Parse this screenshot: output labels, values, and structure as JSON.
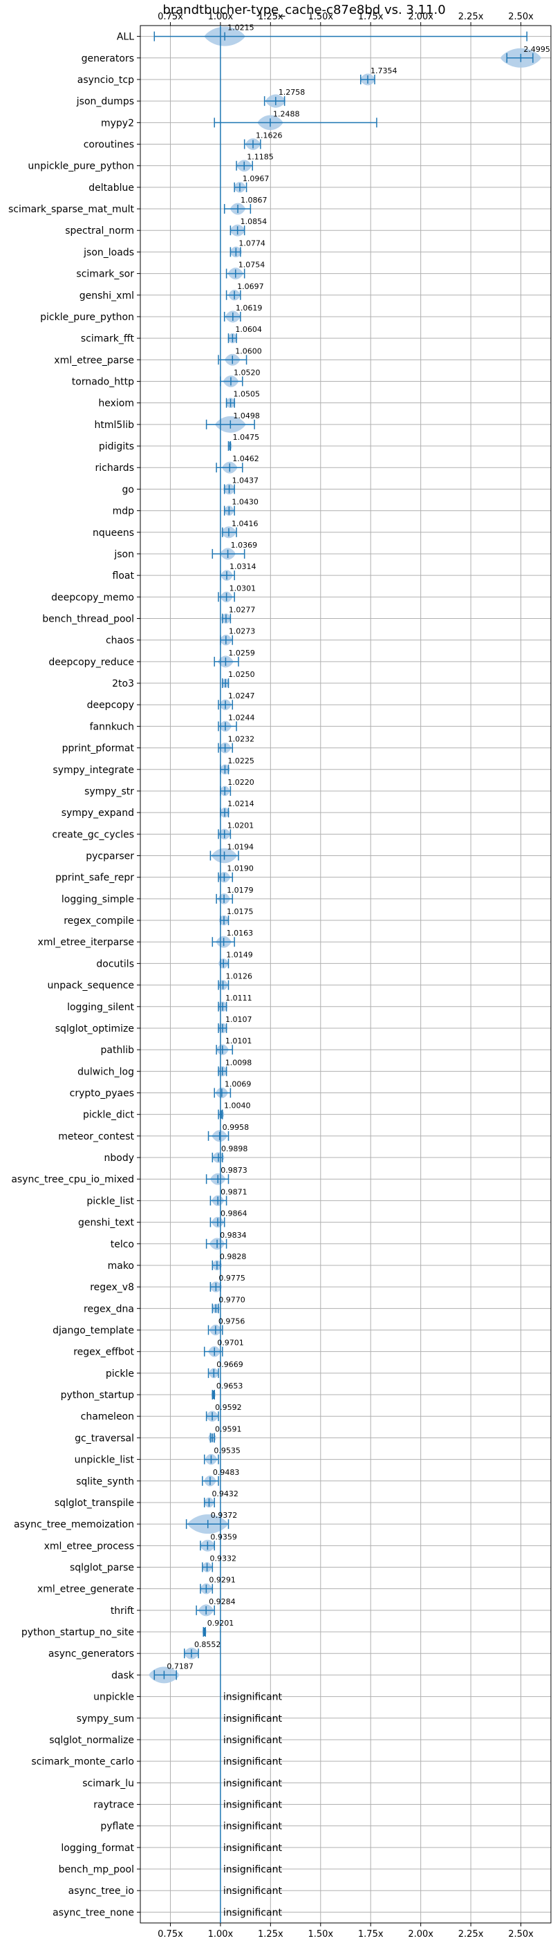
{
  "chart_data": {
    "type": "violin",
    "title": "brandtbucher-type_cache-c87e8bd vs. 3.11.0",
    "xlim": [
      0.6,
      2.65
    ],
    "xticks": [
      "0.75x",
      "1.00x",
      "1.25x",
      "1.50x",
      "1.75x",
      "2.00x",
      "2.25x",
      "2.50x"
    ],
    "xtick_values": [
      0.75,
      1.0,
      1.25,
      1.5,
      1.75,
      2.0,
      2.25,
      2.5
    ],
    "reference_line": 1.0,
    "grid": true,
    "colors": {
      "accent": "#1f77b4",
      "violin_fill": "#a9c9e6",
      "grid": "#b0b0b0"
    },
    "insignificant_label": "insignificant",
    "benchmarks": [
      {
        "name": "ALL",
        "value": 1.0215,
        "label": "1.0215",
        "min": 0.67,
        "max": 2.53,
        "spread": 0.04
      },
      {
        "name": "generators",
        "value": 2.4995,
        "label": "2.4995",
        "min": 2.43,
        "max": 2.56,
        "spread": 0.04
      },
      {
        "name": "asyncio_tcp",
        "value": 1.7354,
        "label": "1.7354",
        "min": 1.7,
        "max": 1.77,
        "spread": 0.015
      },
      {
        "name": "json_dumps",
        "value": 1.2758,
        "label": "1.2758",
        "min": 1.22,
        "max": 1.32,
        "spread": 0.02
      },
      {
        "name": "mypy2",
        "value": 1.2488,
        "label": "1.2488",
        "min": 0.97,
        "max": 1.78,
        "spread": 0.025
      },
      {
        "name": "coroutines",
        "value": 1.1626,
        "label": "1.1626",
        "min": 1.12,
        "max": 1.2,
        "spread": 0.015
      },
      {
        "name": "unpickle_pure_python",
        "value": 1.1185,
        "label": "1.1185",
        "min": 1.08,
        "max": 1.16,
        "spread": 0.015
      },
      {
        "name": "deltablue",
        "value": 1.0967,
        "label": "1.0967",
        "min": 1.07,
        "max": 1.13,
        "spread": 0.012
      },
      {
        "name": "scimark_sparse_mat_mult",
        "value": 1.0867,
        "label": "1.0867",
        "min": 1.02,
        "max": 1.15,
        "spread": 0.015
      },
      {
        "name": "spectral_norm",
        "value": 1.0854,
        "label": "1.0854",
        "min": 1.05,
        "max": 1.12,
        "spread": 0.015
      },
      {
        "name": "json_loads",
        "value": 1.0774,
        "label": "1.0774",
        "min": 1.05,
        "max": 1.1,
        "spread": 0.012
      },
      {
        "name": "scimark_sor",
        "value": 1.0754,
        "label": "1.0754",
        "min": 1.03,
        "max": 1.12,
        "spread": 0.015
      },
      {
        "name": "genshi_xml",
        "value": 1.0697,
        "label": "1.0697",
        "min": 1.03,
        "max": 1.1,
        "spread": 0.012
      },
      {
        "name": "pickle_pure_python",
        "value": 1.0619,
        "label": "1.0619",
        "min": 1.02,
        "max": 1.1,
        "spread": 0.015
      },
      {
        "name": "scimark_fft",
        "value": 1.0604,
        "label": "1.0604",
        "min": 1.04,
        "max": 1.08,
        "spread": 0.01
      },
      {
        "name": "xml_etree_parse",
        "value": 1.06,
        "label": "1.0600",
        "min": 0.99,
        "max": 1.13,
        "spread": 0.015
      },
      {
        "name": "tornado_http",
        "value": 1.052,
        "label": "1.0520",
        "min": 1.0,
        "max": 1.11,
        "spread": 0.015
      },
      {
        "name": "hexiom",
        "value": 1.0505,
        "label": "1.0505",
        "min": 1.03,
        "max": 1.07,
        "spread": 0.01
      },
      {
        "name": "html5lib",
        "value": 1.0498,
        "label": "1.0498",
        "min": 0.93,
        "max": 1.17,
        "spread": 0.03
      },
      {
        "name": "pidigits",
        "value": 1.0475,
        "label": "1.0475",
        "min": 1.04,
        "max": 1.05,
        "spread": 0.004
      },
      {
        "name": "richards",
        "value": 1.0462,
        "label": "1.0462",
        "min": 0.98,
        "max": 1.11,
        "spread": 0.015
      },
      {
        "name": "go",
        "value": 1.0437,
        "label": "1.0437",
        "min": 1.02,
        "max": 1.07,
        "spread": 0.012
      },
      {
        "name": "mdp",
        "value": 1.043,
        "label": "1.0430",
        "min": 1.02,
        "max": 1.07,
        "spread": 0.01
      },
      {
        "name": "nqueens",
        "value": 1.0416,
        "label": "1.0416",
        "min": 1.01,
        "max": 1.08,
        "spread": 0.015
      },
      {
        "name": "json",
        "value": 1.0369,
        "label": "1.0369",
        "min": 0.96,
        "max": 1.12,
        "spread": 0.015
      },
      {
        "name": "float",
        "value": 1.0314,
        "label": "1.0314",
        "min": 1.0,
        "max": 1.07,
        "spread": 0.012
      },
      {
        "name": "deepcopy_memo",
        "value": 1.0301,
        "label": "1.0301",
        "min": 0.99,
        "max": 1.07,
        "spread": 0.012
      },
      {
        "name": "bench_thread_pool",
        "value": 1.0277,
        "label": "1.0277",
        "min": 1.01,
        "max": 1.05,
        "spread": 0.01
      },
      {
        "name": "chaos",
        "value": 1.0273,
        "label": "1.0273",
        "min": 1.0,
        "max": 1.06,
        "spread": 0.012
      },
      {
        "name": "deepcopy_reduce",
        "value": 1.0259,
        "label": "1.0259",
        "min": 0.97,
        "max": 1.09,
        "spread": 0.015
      },
      {
        "name": "2to3",
        "value": 1.025,
        "label": "1.0250",
        "min": 1.01,
        "max": 1.04,
        "spread": 0.008
      },
      {
        "name": "deepcopy",
        "value": 1.0247,
        "label": "1.0247",
        "min": 0.99,
        "max": 1.06,
        "spread": 0.012
      },
      {
        "name": "fannkuch",
        "value": 1.0244,
        "label": "1.0244",
        "min": 0.99,
        "max": 1.08,
        "spread": 0.012
      },
      {
        "name": "pprint_pformat",
        "value": 1.0232,
        "label": "1.0232",
        "min": 0.99,
        "max": 1.06,
        "spread": 0.012
      },
      {
        "name": "sympy_integrate",
        "value": 1.0225,
        "label": "1.0225",
        "min": 1.0,
        "max": 1.04,
        "spread": 0.01
      },
      {
        "name": "sympy_str",
        "value": 1.022,
        "label": "1.0220",
        "min": 1.0,
        "max": 1.05,
        "spread": 0.01
      },
      {
        "name": "sympy_expand",
        "value": 1.0214,
        "label": "1.0214",
        "min": 1.0,
        "max": 1.04,
        "spread": 0.01
      },
      {
        "name": "create_gc_cycles",
        "value": 1.0201,
        "label": "1.0201",
        "min": 0.99,
        "max": 1.05,
        "spread": 0.012
      },
      {
        "name": "pycparser",
        "value": 1.0194,
        "label": "1.0194",
        "min": 0.95,
        "max": 1.09,
        "spread": 0.025
      },
      {
        "name": "pprint_safe_repr",
        "value": 1.019,
        "label": "1.0190",
        "min": 0.99,
        "max": 1.06,
        "spread": 0.012
      },
      {
        "name": "logging_simple",
        "value": 1.0179,
        "label": "1.0179",
        "min": 0.98,
        "max": 1.06,
        "spread": 0.012
      },
      {
        "name": "regex_compile",
        "value": 1.0175,
        "label": "1.0175",
        "min": 1.0,
        "max": 1.04,
        "spread": 0.01
      },
      {
        "name": "xml_etree_iterparse",
        "value": 1.0163,
        "label": "1.0163",
        "min": 0.96,
        "max": 1.07,
        "spread": 0.015
      },
      {
        "name": "docutils",
        "value": 1.0149,
        "label": "1.0149",
        "min": 1.0,
        "max": 1.04,
        "spread": 0.01
      },
      {
        "name": "unpack_sequence",
        "value": 1.0126,
        "label": "1.0126",
        "min": 0.99,
        "max": 1.04,
        "spread": 0.01
      },
      {
        "name": "logging_silent",
        "value": 1.0111,
        "label": "1.0111",
        "min": 0.99,
        "max": 1.03,
        "spread": 0.01
      },
      {
        "name": "sqlglot_optimize",
        "value": 1.0107,
        "label": "1.0107",
        "min": 0.99,
        "max": 1.03,
        "spread": 0.01
      },
      {
        "name": "pathlib",
        "value": 1.0101,
        "label": "1.0101",
        "min": 0.98,
        "max": 1.06,
        "spread": 0.012
      },
      {
        "name": "dulwich_log",
        "value": 1.0098,
        "label": "1.0098",
        "min": 0.99,
        "max": 1.03,
        "spread": 0.01
      },
      {
        "name": "crypto_pyaes",
        "value": 1.0069,
        "label": "1.0069",
        "min": 0.97,
        "max": 1.05,
        "spread": 0.012
      },
      {
        "name": "pickle_dict",
        "value": 1.004,
        "label": "1.0040",
        "min": 0.99,
        "max": 1.01,
        "spread": 0.006
      },
      {
        "name": "meteor_contest",
        "value": 0.9958,
        "label": "0.9958",
        "min": 0.94,
        "max": 1.04,
        "spread": 0.015
      },
      {
        "name": "nbody",
        "value": 0.9898,
        "label": "0.9898",
        "min": 0.96,
        "max": 1.01,
        "spread": 0.012
      },
      {
        "name": "async_tree_cpu_io_mixed",
        "value": 0.9873,
        "label": "0.9873",
        "min": 0.93,
        "max": 1.04,
        "spread": 0.015
      },
      {
        "name": "pickle_list",
        "value": 0.9871,
        "label": "0.9871",
        "min": 0.95,
        "max": 1.03,
        "spread": 0.012
      },
      {
        "name": "genshi_text",
        "value": 0.9864,
        "label": "0.9864",
        "min": 0.95,
        "max": 1.02,
        "spread": 0.012
      },
      {
        "name": "telco",
        "value": 0.9834,
        "label": "0.9834",
        "min": 0.93,
        "max": 1.03,
        "spread": 0.015
      },
      {
        "name": "mako",
        "value": 0.9828,
        "label": "0.9828",
        "min": 0.96,
        "max": 1.0,
        "spread": 0.01
      },
      {
        "name": "regex_v8",
        "value": 0.9775,
        "label": "0.9775",
        "min": 0.95,
        "max": 1.0,
        "spread": 0.012
      },
      {
        "name": "regex_dna",
        "value": 0.977,
        "label": "0.9770",
        "min": 0.96,
        "max": 0.99,
        "spread": 0.008
      },
      {
        "name": "django_template",
        "value": 0.9756,
        "label": "0.9756",
        "min": 0.94,
        "max": 1.01,
        "spread": 0.012
      },
      {
        "name": "regex_effbot",
        "value": 0.9701,
        "label": "0.9701",
        "min": 0.92,
        "max": 1.01,
        "spread": 0.012
      },
      {
        "name": "pickle",
        "value": 0.9669,
        "label": "0.9669",
        "min": 0.94,
        "max": 0.99,
        "spread": 0.01
      },
      {
        "name": "python_startup",
        "value": 0.9653,
        "label": "0.9653",
        "min": 0.96,
        "max": 0.97,
        "spread": 0.004
      },
      {
        "name": "chameleon",
        "value": 0.9592,
        "label": "0.9592",
        "min": 0.93,
        "max": 0.99,
        "spread": 0.012
      },
      {
        "name": "gc_traversal",
        "value": 0.9591,
        "label": "0.9591",
        "min": 0.95,
        "max": 0.97,
        "spread": 0.008
      },
      {
        "name": "unpickle_list",
        "value": 0.9535,
        "label": "0.9535",
        "min": 0.92,
        "max": 0.99,
        "spread": 0.012
      },
      {
        "name": "sqlite_synth",
        "value": 0.9483,
        "label": "0.9483",
        "min": 0.91,
        "max": 0.99,
        "spread": 0.012
      },
      {
        "name": "sqlglot_transpile",
        "value": 0.9432,
        "label": "0.9432",
        "min": 0.92,
        "max": 0.97,
        "spread": 0.01
      },
      {
        "name": "async_tree_memoization",
        "value": 0.9372,
        "label": "0.9372",
        "min": 0.83,
        "max": 1.04,
        "spread": 0.04
      },
      {
        "name": "xml_etree_process",
        "value": 0.9359,
        "label": "0.9359",
        "min": 0.9,
        "max": 0.97,
        "spread": 0.015
      },
      {
        "name": "sqlglot_parse",
        "value": 0.9332,
        "label": "0.9332",
        "min": 0.91,
        "max": 0.96,
        "spread": 0.01
      },
      {
        "name": "xml_etree_generate",
        "value": 0.9291,
        "label": "0.9291",
        "min": 0.9,
        "max": 0.96,
        "spread": 0.012
      },
      {
        "name": "thrift",
        "value": 0.9284,
        "label": "0.9284",
        "min": 0.88,
        "max": 0.97,
        "spread": 0.015
      },
      {
        "name": "python_startup_no_site",
        "value": 0.9201,
        "label": "0.9201",
        "min": 0.915,
        "max": 0.925,
        "spread": 0.004
      },
      {
        "name": "async_generators",
        "value": 0.8552,
        "label": "0.8552",
        "min": 0.82,
        "max": 0.89,
        "spread": 0.015
      },
      {
        "name": "dask",
        "value": 0.7187,
        "label": "0.7187",
        "min": 0.67,
        "max": 0.78,
        "spread": 0.03
      },
      {
        "name": "unpickle",
        "insignificant": true
      },
      {
        "name": "sympy_sum",
        "insignificant": true
      },
      {
        "name": "sqlglot_normalize",
        "insignificant": true
      },
      {
        "name": "scimark_monte_carlo",
        "insignificant": true
      },
      {
        "name": "scimark_lu",
        "insignificant": true
      },
      {
        "name": "raytrace",
        "insignificant": true
      },
      {
        "name": "pyflate",
        "insignificant": true
      },
      {
        "name": "logging_format",
        "insignificant": true
      },
      {
        "name": "bench_mp_pool",
        "insignificant": true
      },
      {
        "name": "async_tree_io",
        "insignificant": true
      },
      {
        "name": "async_tree_none",
        "insignificant": true
      }
    ]
  }
}
